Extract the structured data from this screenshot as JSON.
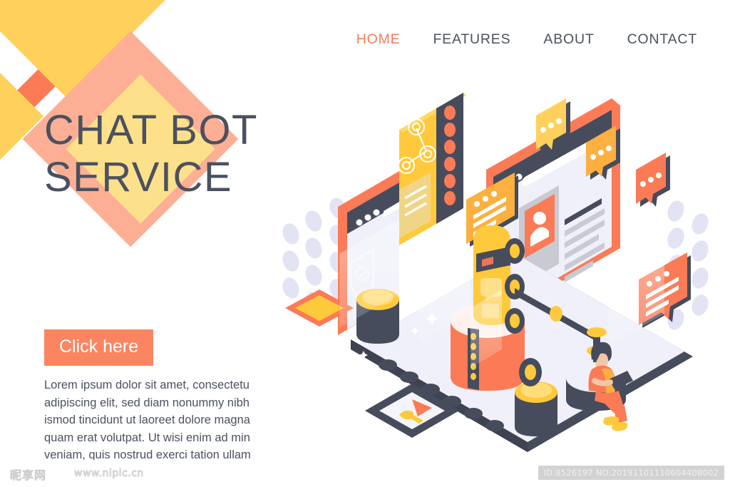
{
  "nav": {
    "items": [
      {
        "label": "HOME",
        "active": true
      },
      {
        "label": "FEATURES",
        "active": false
      },
      {
        "label": "ABOUT",
        "active": false
      },
      {
        "label": "CONTACT",
        "active": false
      }
    ]
  },
  "hero": {
    "title": "CHAT BOT\nSERVICE",
    "cta_label": "Click here",
    "body": "Lorem ipsum dolor sit amet, consectetu adipiscing elit, sed diam nonummy nibh ismod tincidunt ut laoreet dolore magna quam erat volutpat. Ut wisi enim ad min veniam, quis nostrud exerci tation ullam"
  },
  "illustration": {
    "name": "isometric-chatbot-scene",
    "elements": [
      "tablet-device-left",
      "yellow-network-card",
      "browser-window-right",
      "user-profile-card",
      "speech-bubble-yellow",
      "speech-bubble-orange",
      "speech-bubble-coral",
      "chat-bubble-orange-left",
      "chat-bubble-coral-right",
      "robot-character",
      "orange-cylinder",
      "gold-cylinder-left",
      "gold-cylinder-right",
      "seated-person-with-tablet",
      "floating-yellow-tile",
      "floating-flag-tile",
      "shield-icon-panel",
      "dot-grid-left",
      "dot-grid-right"
    ]
  },
  "colors": {
    "accent_coral": "#FA7B56",
    "accent_orange": "#FB8560",
    "accent_yellow": "#FFD15C",
    "accent_yellow_light": "#FDE08A",
    "accent_salmon": "#FCAF94",
    "text_dark": "#4A5160",
    "panel_light": "#EFF0F9",
    "dot_lavender": "#E2E4F4"
  },
  "watermark": {
    "logo": "昵享网",
    "url": "www.nipic.cn",
    "id": "ID:8526197 NO:20191101110604408002"
  }
}
